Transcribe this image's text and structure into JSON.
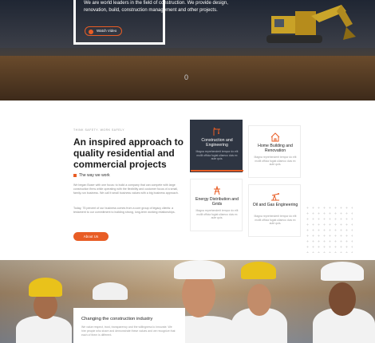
{
  "hero": {
    "lead_text": "We are world leaders in the field of construction. We provide design, renovation, build, construction management and other projects.",
    "watch_label": "Watch Video",
    "slide_counter": "0"
  },
  "about": {
    "eyebrow": "THINK SAFETY. WORK SAFELY",
    "heading_1": "An inspired approach to quality ",
    "heading_bold_1": "residential",
    "heading_2": " and ",
    "heading_bold_2": "commercial",
    "heading_3": " projects",
    "way_label": "The way we work",
    "paragraph_1": "We began Buser with one focus: to build a company that can compete with large construction firms while operating with the flexibility and customer focus of a small, family-run business. We call it small business values with a big business approach.",
    "paragraph_2": "Today, 75 percent of our business comes from a core group of legacy clients: a testament to our commitment to building strong, long-term working relationships.",
    "button_label": "About Us"
  },
  "services": [
    {
      "title": "Construction and Engineering",
      "text": "Magna reprehenderit tempor do elit mollit officia fugiat ullamco duis ex aute quis."
    },
    {
      "title": "Home Building and Renovation",
      "text": "Magna reprehenderit tempor do elit mollit officia fugiat ullamco duis ex aute quis."
    },
    {
      "title": "Energy Distribution and Grids",
      "text": "Magna reprehenderit tempor do elit mollit officia fugiat ullamco duis ex aute quis."
    },
    {
      "title": "Oil and Gas Engineering",
      "text": "Magna reprehenderit tempor do elit mollit officia fugiat ullamco duis ex aute quis."
    }
  ],
  "workers": {
    "title": "Changing the construction industry",
    "text": "We value respect, trust, transparency and the willingness to innovate. We hire people who share and demonstrate these values and we recognize that each of them is different."
  },
  "colors": {
    "accent": "#e85d25",
    "dark": "#2e3542"
  },
  "icons": [
    "crane-icon",
    "house-icon",
    "power-tower-icon",
    "oil-pump-icon",
    "play-icon"
  ]
}
